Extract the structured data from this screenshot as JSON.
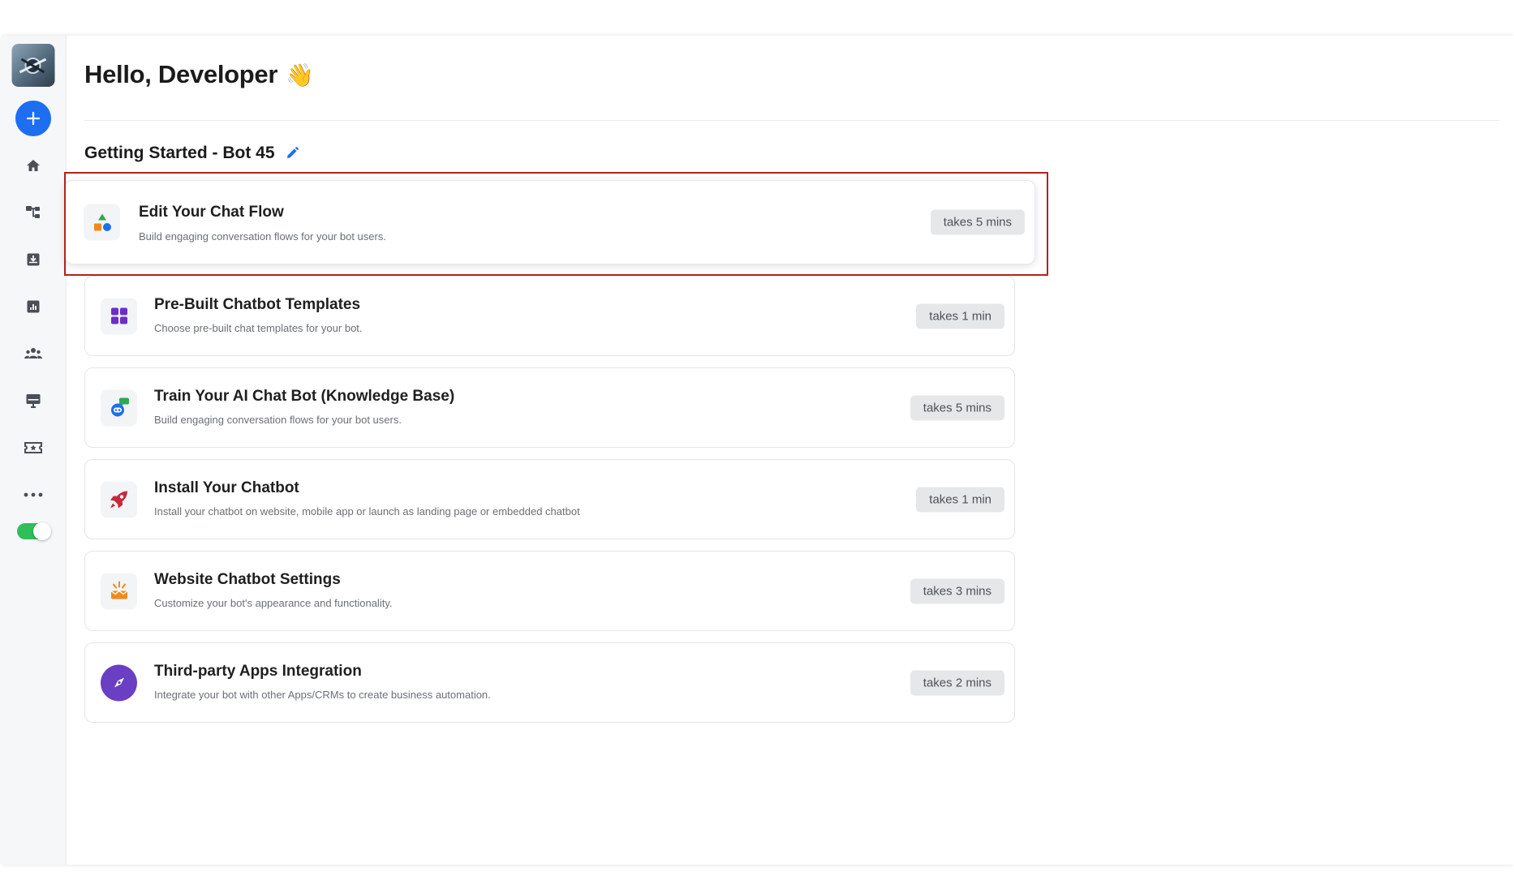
{
  "greeting": {
    "text": "Hello, Developer",
    "emoji": "👋"
  },
  "section": {
    "title": "Getting Started - Bot 45"
  },
  "cards": [
    {
      "title": "Edit Your Chat Flow",
      "description": "Build engaging conversation flows for your bot users.",
      "time": "takes 5 mins",
      "icon": "shapes-icon"
    },
    {
      "title": "Pre-Built Chatbot Templates",
      "description": "Choose pre-built chat templates for your bot.",
      "time": "takes 1 min",
      "icon": "grid-icon"
    },
    {
      "title": "Train Your AI Chat Bot (Knowledge Base)",
      "description": "Build engaging conversation flows for your bot users.",
      "time": "takes 5 mins",
      "icon": "bot-chat-icon"
    },
    {
      "title": "Install Your Chatbot",
      "description": "Install your chatbot on website, mobile app or launch as landing page or embedded chatbot",
      "time": "takes 1 min",
      "icon": "rocket-icon"
    },
    {
      "title": "Website Chatbot Settings",
      "description": "Customize your bot's appearance and functionality.",
      "time": "takes 3 mins",
      "icon": "bot-settings-icon"
    },
    {
      "title": "Third-party Apps Integration",
      "description": "Integrate your bot with other Apps/CRMs to create business automation.",
      "time": "takes 2 mins",
      "icon": "compass-icon"
    }
  ],
  "colors": {
    "primary": "#1d6ef0",
    "toggle_on": "#2fbf5a",
    "highlight": "#b3231f",
    "badge_bg": "#e6e7e9"
  }
}
